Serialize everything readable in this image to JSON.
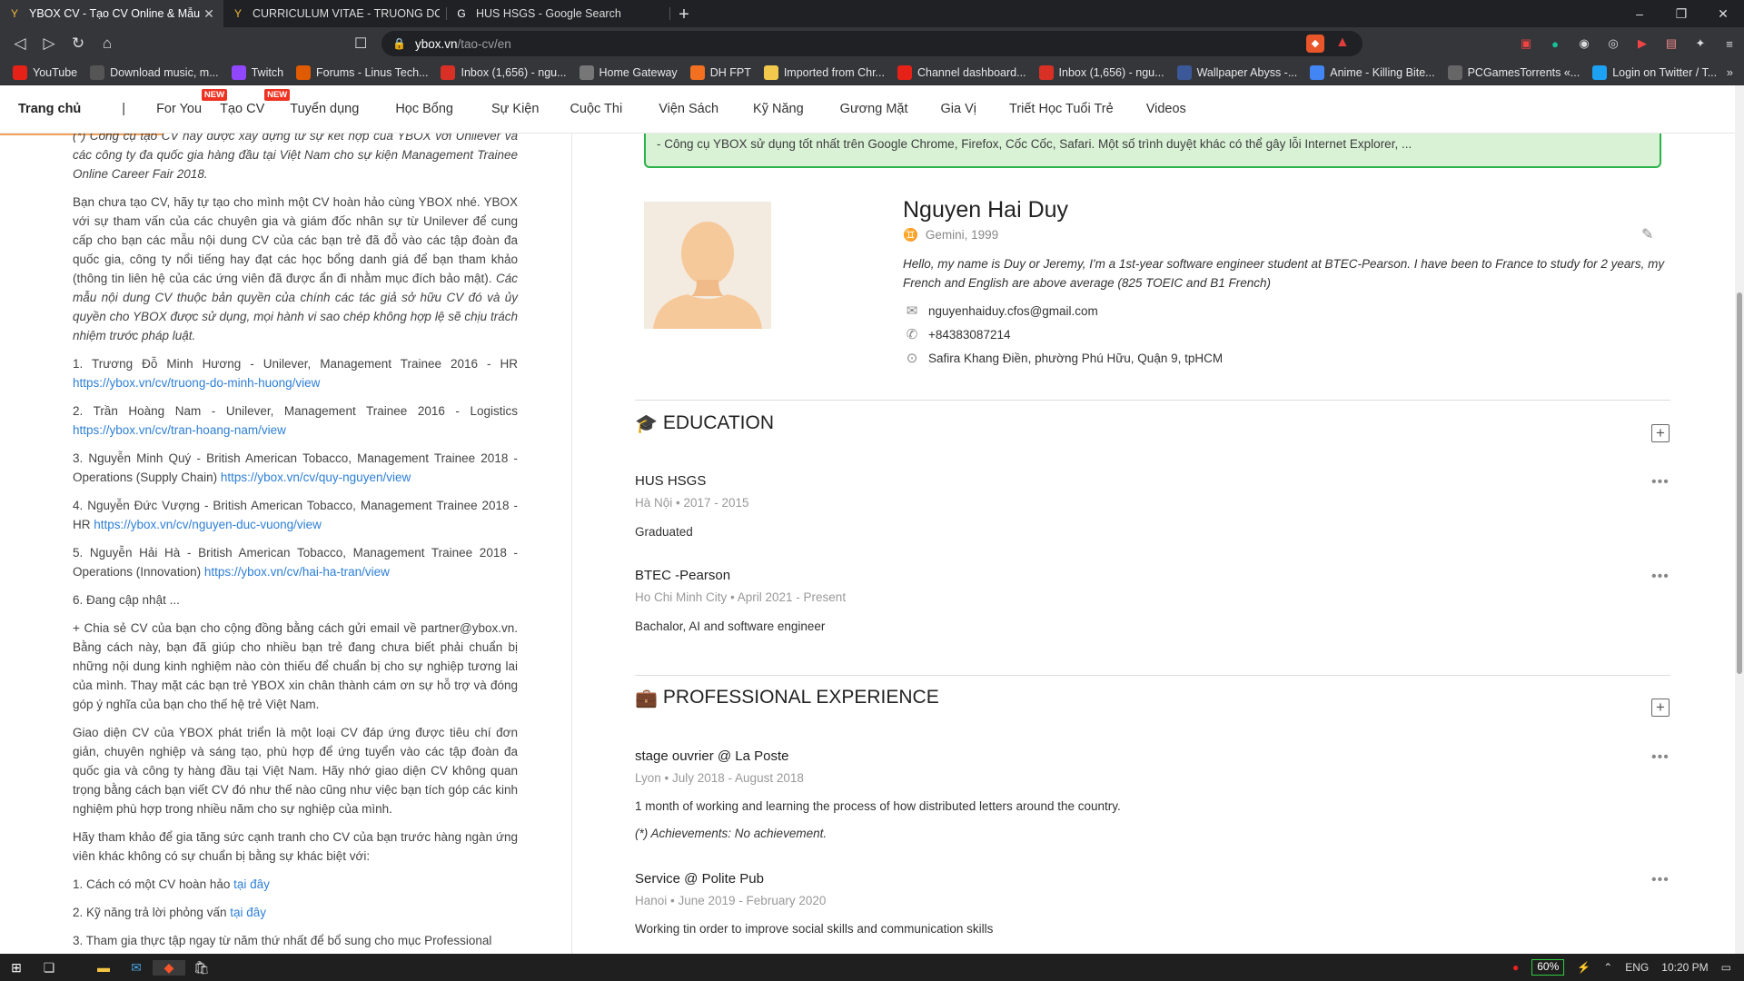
{
  "browser": {
    "tabs": [
      {
        "title": "YBOX CV - Tạo CV Online & Mẫu",
        "active": true,
        "icon": "ybox-favicon"
      },
      {
        "title": "CURRICULUM VITAE - TRUONG DO M",
        "active": false,
        "icon": "ybox-favicon"
      },
      {
        "title": "HUS HSGS - Google Search",
        "active": false,
        "icon": "google-favicon"
      }
    ],
    "url_host": "ybox.vn",
    "url_path": "/tao-cv/en",
    "bookmarks": [
      {
        "label": "YouTube",
        "color": "#e62117"
      },
      {
        "label": "Download music, m...",
        "color": "#555555"
      },
      {
        "label": "Twitch",
        "color": "#9146ff"
      },
      {
        "label": "Forums - Linus Tech...",
        "color": "#e05a00"
      },
      {
        "label": "Inbox (1,656) - ngu...",
        "color": "#d93025"
      },
      {
        "label": "Home Gateway",
        "color": "#777777"
      },
      {
        "label": "DH FPT",
        "color": "#f37021"
      },
      {
        "label": "Imported from Chr...",
        "color": "#f2c94c"
      },
      {
        "label": "Channel dashboard...",
        "color": "#e62117"
      },
      {
        "label": "Inbox (1,656) - ngu...",
        "color": "#d93025"
      },
      {
        "label": "Wallpaper Abyss -...",
        "color": "#3b5998"
      },
      {
        "label": "Anime - Killing Bite...",
        "color": "#4285f4"
      },
      {
        "label": "PCGamesTorrents «...",
        "color": "#666666"
      },
      {
        "label": "Login on Twitter / T...",
        "color": "#1da1f2"
      }
    ]
  },
  "site_nav": {
    "items": [
      {
        "label": "Trang chủ"
      },
      {
        "label": "|"
      },
      {
        "label": "For You",
        "badge": "NEW"
      },
      {
        "label": "Tạo CV",
        "badge": "NEW"
      },
      {
        "label": "Tuyển dụng"
      },
      {
        "label": "Học Bổng"
      },
      {
        "label": "Sự Kiện"
      },
      {
        "label": "Cuộc Thi"
      },
      {
        "label": "Viện Sách"
      },
      {
        "label": "Kỹ Năng"
      },
      {
        "label": "Gương Mặt"
      },
      {
        "label": "Gia Vị"
      },
      {
        "label": "Triết Học Tuổi Trẻ"
      },
      {
        "label": "Videos"
      }
    ]
  },
  "left": {
    "intro_italic": "(*) Công cụ tạo CV hay được xây dựng từ sự kết hợp của YBOX với Unilever và các công ty đa quốc gia hàng đầu tại Việt Nam cho sự kiện Management Trainee Online Career Fair 2018.",
    "para1": "Bạn chưa tạo CV, hãy tự tạo cho mình một CV hoàn hảo cùng YBOX nhé. YBOX với sự tham vấn của các chuyên gia và giám đốc nhân sự từ Unilever để cung cấp cho bạn các mẫu nội dung CV của các bạn trẻ đã đỗ vào các tập đoàn đa quốc gia, công ty nổi tiếng hay đạt các học bổng danh giá để bạn tham khảo (thông tin liên hệ của các ứng viên đã được ẩn đi nhằm mục đích bảo mật).",
    "para1_italic": "Các mẫu nội dung CV thuộc bản quyền của chính các tác giả sở hữu CV đó và ủy quyền cho YBOX được sử dụng, mọi hành vi sao chép không hợp lệ sẽ chịu trách nhiệm trước pháp luật.",
    "samples": [
      {
        "text": "1. Trương Đỗ Minh Hương - Unilever, Management Trainee 2016 - HR",
        "link": "https://ybox.vn/cv/truong-do-minh-huong/view"
      },
      {
        "text": "2. Trần Hoàng Nam - Unilever, Management Trainee 2016 - Logistics",
        "link": "https://ybox.vn/cv/tran-hoang-nam/view"
      },
      {
        "text": "3. Nguyễn Minh Quý - British American Tobacco, Management Trainee 2018 - Operations (Supply Chain)",
        "link": "https://ybox.vn/cv/quy-nguyen/view"
      },
      {
        "text": "4. Nguyễn Đức Vượng - British American Tobacco, Management Trainee 2018 - HR",
        "link": "https://ybox.vn/cv/nguyen-duc-vuong/view"
      },
      {
        "text": "5. Nguyễn Hải Hà - British American Tobacco, Management Trainee 2018 - Operations (Innovation)",
        "link": "https://ybox.vn/cv/hai-ha-tran/view"
      }
    ],
    "updating": "6. Đang cập nhật ...",
    "share": "+ Chia sẻ CV của bạn cho cộng đồng bằng cách gửi email về partner@ybox.vn. Bằng cách này, bạn đã giúp cho nhiều bạn trẻ đang chưa biết phải chuẩn bị những nội dung kinh nghiệm nào còn thiếu để chuẩn bị cho sự nghiệp tương lai của mình. Thay mặt các bạn trẻ YBOX xin chân thành cám ơn sự hỗ trợ và đóng góp ý nghĩa của bạn cho thế hệ trẻ Việt Nam.",
    "para2": "Giao diện CV của YBOX phát triển là một loại CV đáp ứng được tiêu chí đơn giản, chuyên nghiệp và sáng tạo, phù hợp để ứng tuyển vào các tập đoàn đa quốc gia và công ty hàng đầu tại Việt Nam. Hãy nhớ giao diện CV không quan trọng bằng cách bạn viết CV đó như thế nào cũng như việc bạn tích góp các kinh nghiệm phù hợp trong nhiều năm cho sự nghiệp của mình.",
    "para3": "Hãy tham khảo để gia tăng sức cạnh tranh cho CV của bạn trước hàng ngàn ứng viên khác không có sự chuẩn bị bằng sự khác biệt với:",
    "tips": [
      {
        "text": "1. Cách có một CV hoàn hảo ",
        "link": "tại đây"
      },
      {
        "text": "2. Kỹ năng trả lời phỏng vấn ",
        "link": "tại đây"
      },
      {
        "text": "3. Tham gia thực tập ngay từ năm thứ nhất để bổ sung cho mục Professional",
        "link": ""
      }
    ]
  },
  "cv": {
    "notice": "- Công cụ YBOX sử dụng tốt nhất trên Google Chrome, Firefox, Cốc Cốc, Safari. Một số trình duyệt khác có thể gây lỗi Internet Explorer, ...",
    "name": "Nguyen Hai Duy",
    "meta": "Gemini, 1999",
    "bio": "Hello, my name is Duy or Jeremy, I'm a 1st-year software engineer student at BTEC-Pearson. I have been to France to study for 2 years, my French and English are above average (825 TOEIC and B1 French)",
    "email": "nguyenhaiduy.cfos@gmail.com",
    "phone": "+84383087214",
    "address": "Safira Khang Điền, phường Phú Hữu, Quận 9, tpHCM",
    "education_title": "EDUCATION",
    "education": [
      {
        "title": "HUS HSGS",
        "sub": "Hà Nội • 2017 - 2015",
        "desc": "Graduated"
      },
      {
        "title": "BTEC -Pearson",
        "sub": "Ho Chi Minh City • April 2021 - Present",
        "desc": "Bachalor, AI and software engineer"
      }
    ],
    "experience_title": "PROFESSIONAL EXPERIENCE",
    "experience": [
      {
        "title": "stage ouvrier @ La Poste",
        "sub": "Lyon • July 2018 - August 2018",
        "desc": "1 month of working and learning the process of how distributed letters around the country.",
        "ach": "(*) Achievements: No achievement."
      },
      {
        "title": "Service @ Polite Pub",
        "sub": "Hanoi • June 2019 - February 2020",
        "desc": "Working tin order to improve social skills and communication skills"
      }
    ]
  },
  "taskbar": {
    "battery": "60%",
    "lang": "ENG",
    "time": "10:20 PM"
  }
}
